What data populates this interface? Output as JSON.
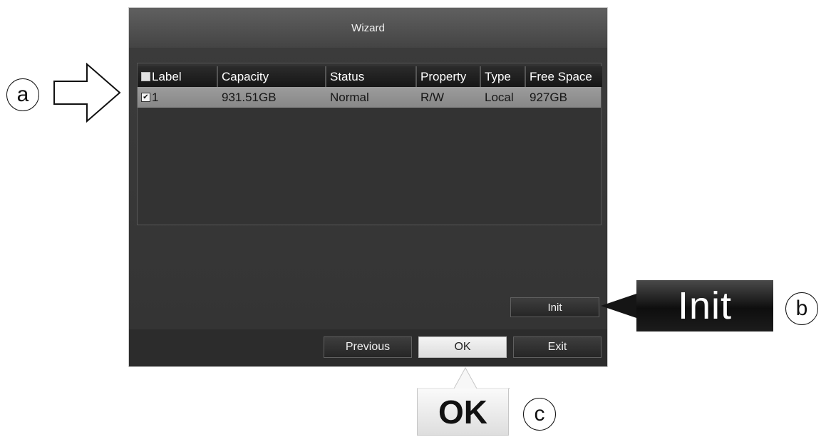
{
  "dialog": {
    "title": "Wizard"
  },
  "table": {
    "headers": {
      "label": "Label",
      "capacity": "Capacity",
      "status": "Status",
      "property": "Property",
      "type": "Type",
      "free_space": "Free Space"
    },
    "rows": [
      {
        "label": "1",
        "checked": true,
        "capacity": "931.51GB",
        "status": "Normal",
        "property": "R/W",
        "type": "Local",
        "free_space": "927GB"
      }
    ]
  },
  "buttons": {
    "init": "Init",
    "previous": "Previous",
    "ok": "OK",
    "exit": "Exit"
  },
  "callouts": {
    "a": "a",
    "b": "b",
    "c": "c",
    "init_label": "Init",
    "ok_label": "OK"
  },
  "icons": {
    "row_checkbox": "checkbox-checked-icon",
    "header_checkbox": "checkbox-unchecked-icon",
    "arrow": "right-arrow-outline-icon"
  },
  "colors": {
    "dialog_background": "#3a3a3a",
    "selected_row": "#909090",
    "ok_button": "#e8e8e8",
    "init_label": "#111111"
  }
}
